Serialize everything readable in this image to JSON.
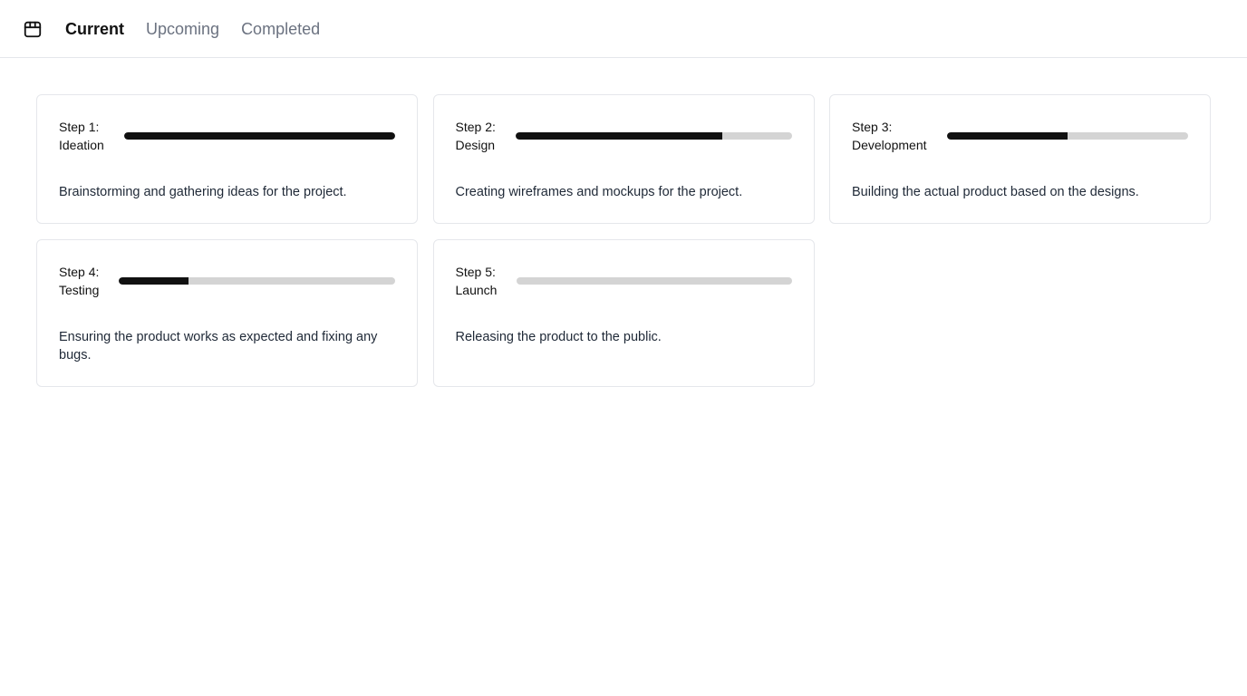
{
  "nav": {
    "logo_icon": "package-icon",
    "tabs": [
      {
        "label": "Current",
        "active": true
      },
      {
        "label": "Upcoming",
        "active": false
      },
      {
        "label": "Completed",
        "active": false
      }
    ]
  },
  "steps": [
    {
      "label": "Step 1:\nIdeation",
      "progress": 1.0,
      "description": "Brainstorming and gathering ideas for the project."
    },
    {
      "label": "Step 2:\nDesign",
      "progress": 0.75,
      "description": "Creating wireframes and mockups for the project."
    },
    {
      "label": "Step 3:\nDevelopment",
      "progress": 0.5,
      "description": "Building the actual product based on the designs."
    },
    {
      "label": "Step 4:\nTesting",
      "progress": 0.25,
      "description": "Ensuring the product works as expected and fixing any bugs."
    },
    {
      "label": "Step 5:\nLaunch",
      "progress": 0.0,
      "description": "Releasing the product to the public."
    }
  ]
}
